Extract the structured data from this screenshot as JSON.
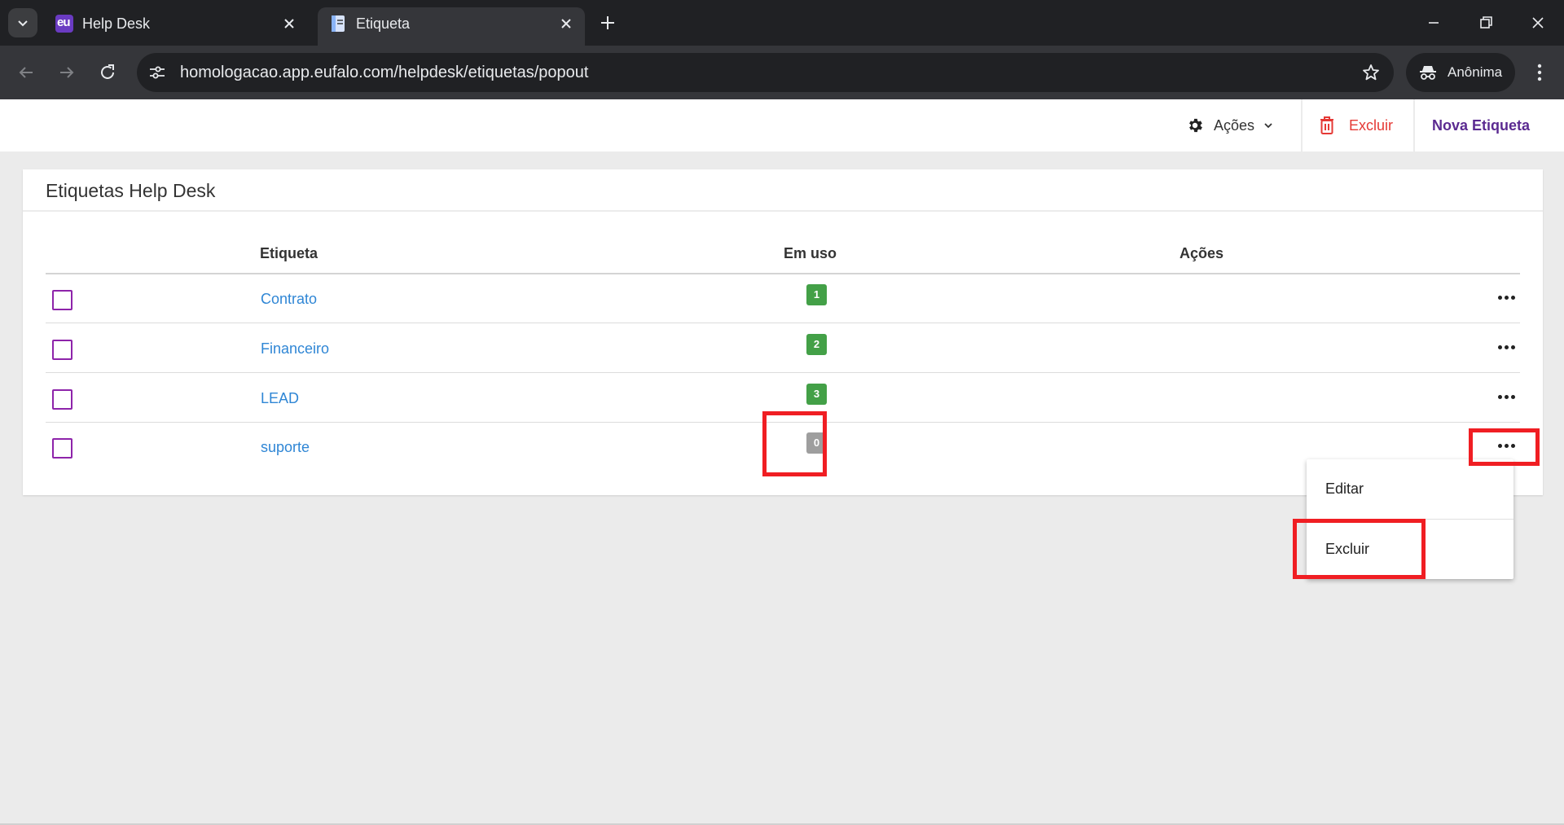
{
  "browser": {
    "tabs": [
      {
        "title": "Help Desk",
        "favicon": "eu-logo-icon",
        "favicon_text": "eu",
        "active": false
      },
      {
        "title": "Etiqueta",
        "favicon": "document-icon",
        "active": true
      }
    ],
    "url": "homologacao.app.eufalo.com/helpdesk/etiquetas/popout",
    "profile_label": "Anônima"
  },
  "header": {
    "acoes_label": "Ações",
    "excluir_label": "Excluir",
    "nova_label": "Nova Etiqueta"
  },
  "card": {
    "title": "Etiquetas Help Desk",
    "columns": [
      "Etiqueta",
      "Em uso",
      "Ações"
    ],
    "rows": [
      {
        "label": "Contrato",
        "in_use": "1",
        "status": "green"
      },
      {
        "label": "Financeiro",
        "in_use": "2",
        "status": "green"
      },
      {
        "label": "LEAD",
        "in_use": "3",
        "status": "green"
      },
      {
        "label": "suporte",
        "in_use": "0",
        "status": "gray"
      }
    ]
  },
  "menu": {
    "items": [
      "Editar",
      "Excluir"
    ]
  },
  "colors": {
    "accent_purple": "#5b2a91",
    "checkbox_purple": "#8e24aa",
    "link_blue": "#2f86d5",
    "danger_red": "#e53935",
    "badge_green": "#43a047",
    "badge_gray": "#9e9e9e",
    "highlight_red": "#f01e23"
  }
}
